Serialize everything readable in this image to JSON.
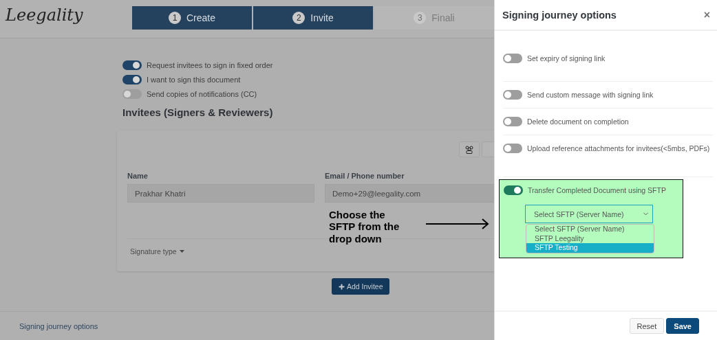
{
  "header": {
    "logo": "Leegality",
    "steps": [
      {
        "number": "1",
        "label": "Create",
        "selected": true
      },
      {
        "number": "2",
        "label": "Invite",
        "selected": true
      },
      {
        "number": "3",
        "label": "Finali",
        "selected": false
      }
    ]
  },
  "settings": [
    {
      "label": "Request invitees to sign in fixed order",
      "on": true
    },
    {
      "label": "I want to sign this document",
      "on": true
    },
    {
      "label": "Send copies of notifications (CC)",
      "on": false
    }
  ],
  "section_title": "Invitees (Signers & Reviewers)",
  "invitee": {
    "fields": [
      {
        "label": "Name",
        "value": "Prakhar Khatri"
      },
      {
        "label": "Email / Phone number",
        "value": "Demo+29@leegality.com"
      }
    ],
    "signature_type": "Signature type"
  },
  "add_button": "Add Invitee",
  "footer_link": "Signing journey options",
  "annotation": {
    "text": "Choose the SFTP from the drop down"
  },
  "drawer": {
    "title": "Signing journey options",
    "close": "×",
    "options": [
      {
        "label": "Set expiry of signing link",
        "on": false
      },
      {
        "label": "Send custom message with signing link",
        "on": false
      },
      {
        "label": "Delete document on completion",
        "on": false
      },
      {
        "label": "Upload reference attachments for invitees(<5mbs, PDFs)",
        "on": false
      }
    ],
    "sftp": {
      "label": "Transfer Completed Document using SFTP",
      "on": true,
      "select": "Select SFTP (Server Name)",
      "choices": [
        {
          "label": "Select SFTP (Server Name)",
          "selected": false
        },
        {
          "label": "SFTP Leegality",
          "selected": false
        },
        {
          "label": "SFTP Testing",
          "selected": true
        }
      ]
    },
    "buttons": [
      {
        "label": "Reset",
        "kind": "secondary"
      },
      {
        "label": "Save",
        "kind": "primary"
      }
    ]
  }
}
